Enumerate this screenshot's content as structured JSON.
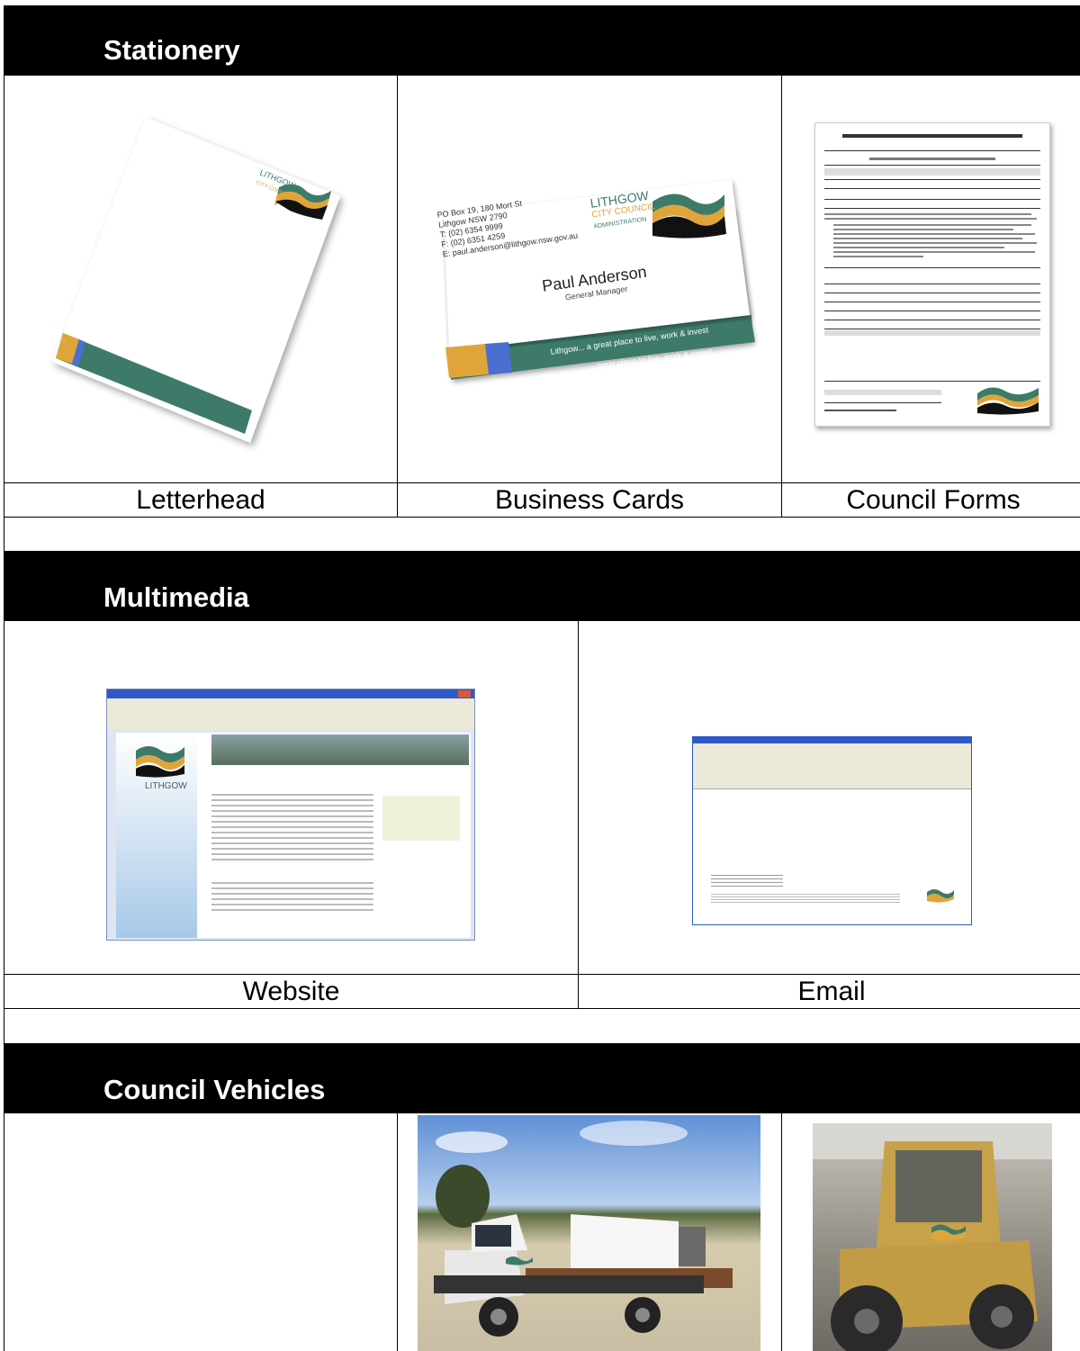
{
  "sections": {
    "stationery": {
      "title": "Stationery",
      "captions": [
        "Letterhead",
        "Business Cards",
        "Council Forms"
      ]
    },
    "multimedia": {
      "title": "Multimedia",
      "captions": [
        "Website",
        "Email"
      ]
    },
    "vehicles": {
      "title": "Council Vehicles"
    }
  },
  "business_card": {
    "address_lines": [
      "PO Box 19, 180 Mort St",
      "Lithgow NSW 2790",
      "T: (02) 6354 9999",
      "F: (02) 6351 4259",
      "E: paul.anderson@lithgow.nsw.gov.au"
    ],
    "name": "Paul Anderson",
    "role": "General Manager",
    "tagline": "Lithgow... a great place to live, work & invest",
    "tagline_back": "...great place to live, work & invest"
  },
  "logo": {
    "line1": "LITHGOW",
    "line2": "CITY COUNCIL",
    "line3": "ADMINISTRATION"
  },
  "colors": {
    "bar": "#000000",
    "teal": "#3d7a6a",
    "gold": "#e0a53a",
    "blue": "#4a6fd0",
    "sky": "#a8c8e8"
  }
}
